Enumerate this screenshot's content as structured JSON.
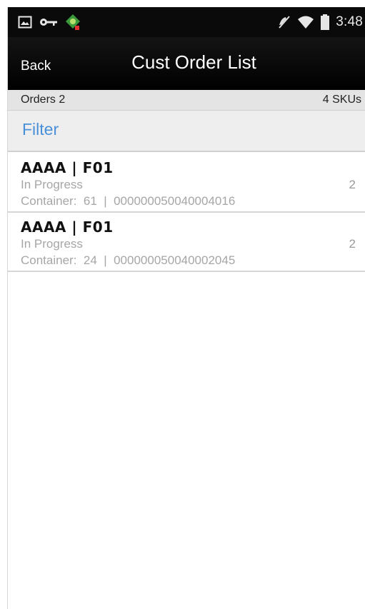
{
  "status_bar": {
    "time": "3:48",
    "left_icons": [
      "image-icon",
      "key-icon",
      "android-icon"
    ],
    "right_icons": [
      "mute-icon",
      "wifi-icon",
      "battery-icon"
    ]
  },
  "action_bar": {
    "back_label": "Back",
    "title": "Cust Order List"
  },
  "summary": {
    "orders": "Orders 2",
    "skus": "4 SKUs"
  },
  "filter": {
    "label": "Filter"
  },
  "orders": [
    {
      "header": "AAAA  |  F01",
      "status": "In Progress",
      "container": "Container:  61  |  000000050040004016",
      "count": "2"
    },
    {
      "header": "AAAA  |  F01",
      "status": "In Progress",
      "container": "Container:  24  |  000000050040002045",
      "count": "2"
    }
  ],
  "colors": {
    "accent": "#4a90d9",
    "action_bar": "#000000",
    "muted_text": "#a6a6a6"
  }
}
